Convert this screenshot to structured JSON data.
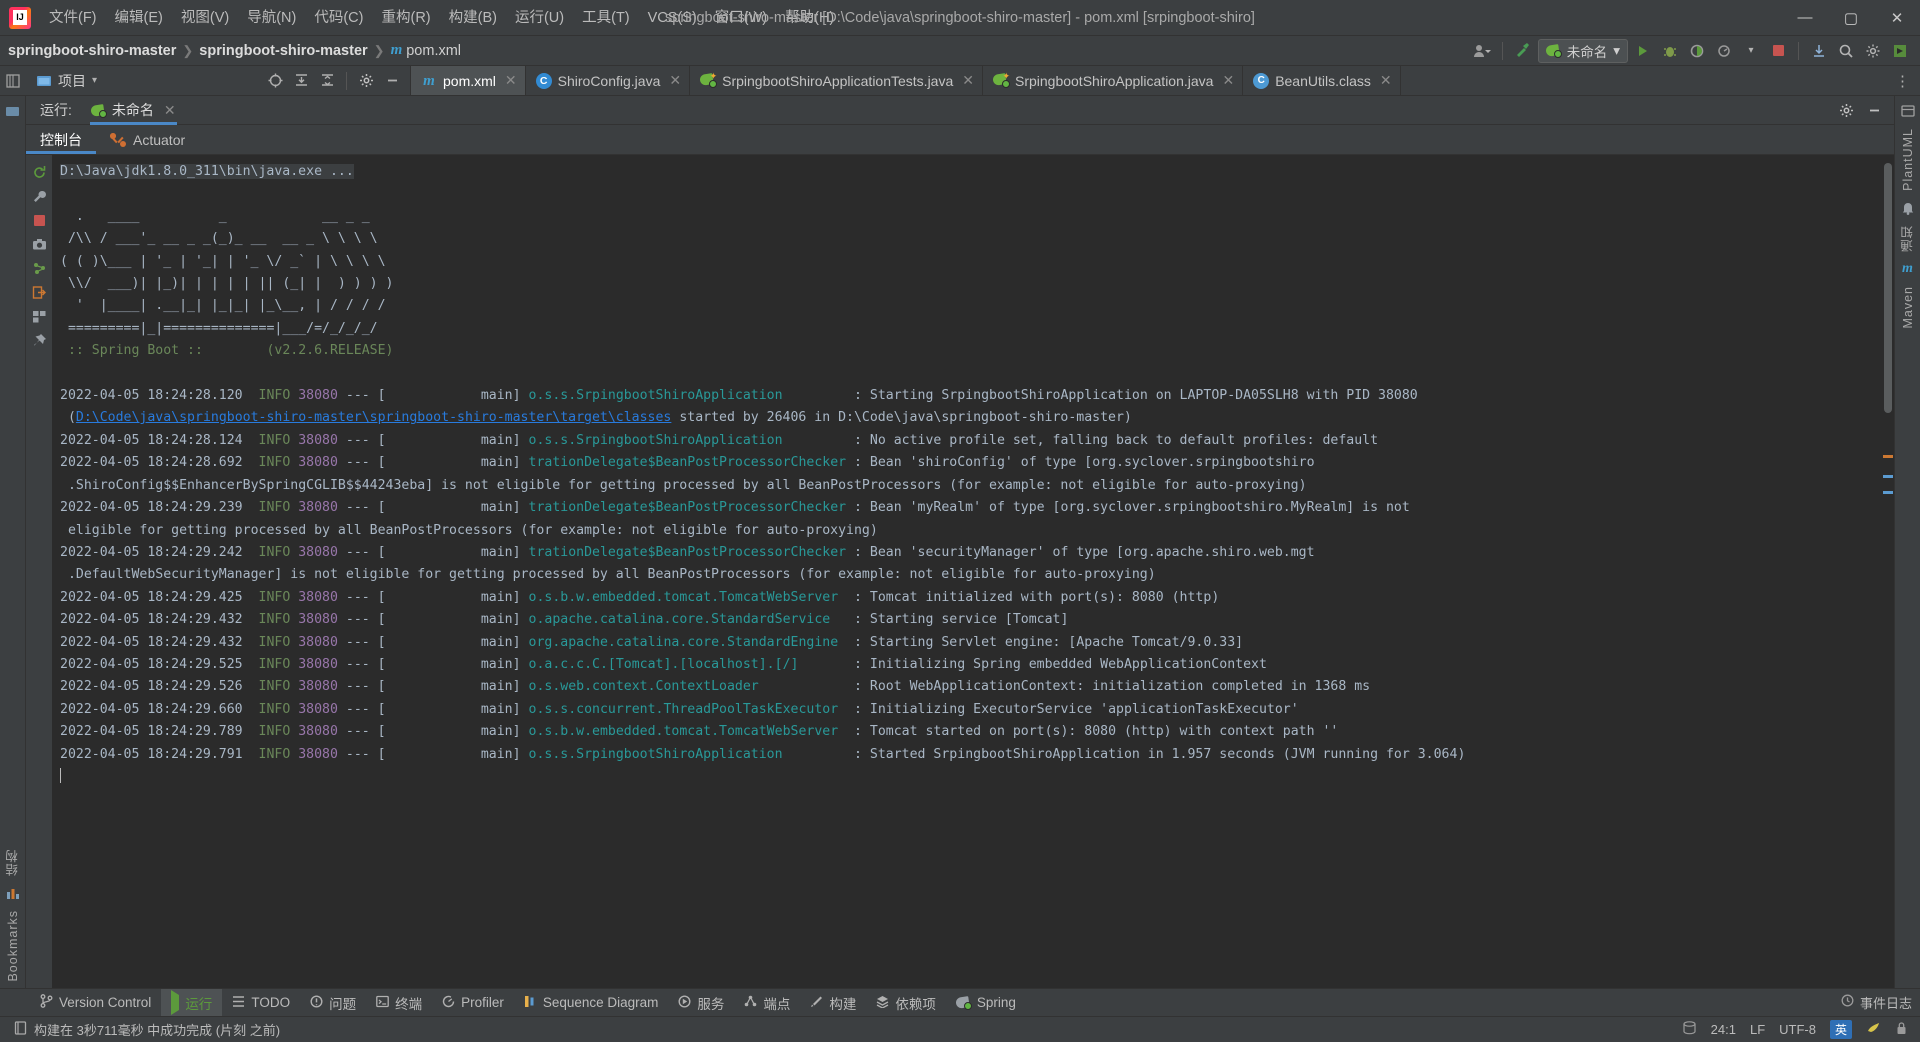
{
  "window": {
    "title": "springboot-shiro-master [D:\\Code\\java\\springboot-shiro-master] - pom.xml [srpingboot-shiro]",
    "minimize": "—",
    "maximize": "▢",
    "close": "✕"
  },
  "menu": {
    "items": [
      "文件(F)",
      "编辑(E)",
      "视图(V)",
      "导航(N)",
      "代码(C)",
      "重构(R)",
      "构建(B)",
      "运行(U)",
      "工具(T)",
      "VCS(S)",
      "窗口(W)",
      "帮助(H)"
    ]
  },
  "breadcrumb": {
    "root": "springboot-shiro-master",
    "module": "springboot-shiro-master",
    "file": "pom.xml",
    "sep": "❯"
  },
  "toolbar": {
    "run_config_name": "未命名",
    "search_icon": "🔍",
    "settings_icon": "⚙",
    "chevron": "▾"
  },
  "project_panel": {
    "label": "项目",
    "chevron": "▾"
  },
  "editor_tabs": [
    {
      "label": "pom.xml",
      "icon": "maven-icon",
      "active": true
    },
    {
      "label": "ShiroConfig.java",
      "icon": "java-class-icon",
      "active": false
    },
    {
      "label": "SrpingbootShiroApplicationTests.java",
      "icon": "spring-boot-icon",
      "active": false
    },
    {
      "label": "SrpingbootShiroApplication.java",
      "icon": "spring-boot-icon",
      "active": false
    },
    {
      "label": "BeanUtils.class",
      "icon": "compiled-class-icon",
      "active": false
    }
  ],
  "run_window": {
    "label": "运行:",
    "config_name": "未命名",
    "close": "✕",
    "subtabs": [
      {
        "label": "控制台",
        "active": true
      },
      {
        "label": "Actuator",
        "active": false
      }
    ]
  },
  "console": {
    "command": "D:\\Java\\jdk1.8.0_311\\bin\\java.exe ...",
    "banner": [
      "  .   ____          _            __ _ _",
      " /\\\\ / ___'_ __ _ _(_)_ __  __ _ \\ \\ \\ \\",
      "( ( )\\___ | '_ | '_| | '_ \\/ _` | \\ \\ \\ \\",
      " \\\\/  ___)| |_)| | | | | || (_| |  ) ) ) )",
      "  '  |____| .__|_| |_|_| |_\\__, | / / / /",
      " =========|_|==============|___/=/_/_/_/"
    ],
    "spring_tag": " :: Spring Boot ::        (v2.2.6.RELEASE)",
    "log_lines": [
      {
        "time": "2022-04-05 18:24:28.120",
        "level": "INFO",
        "pid": "38080",
        "thread": "main",
        "logger": "o.s.s.SrpingbootShiroApplication",
        "message": ": Starting SrpingbootShiroApplication on LAPTOP-DA05SLH8 with PID 38080",
        "continuation": "(D:\\Code\\java\\springboot-shiro-master\\springboot-shiro-master\\target\\classes started by 26406 in D:\\Code\\java\\springboot-shiro-master)",
        "continuation_link": "D:\\Code\\java\\springboot-shiro-master\\springboot-shiro-master\\target\\classes"
      },
      {
        "time": "2022-04-05 18:24:28.124",
        "level": "INFO",
        "pid": "38080",
        "thread": "main",
        "logger": "o.s.s.SrpingbootShiroApplication",
        "message": ": No active profile set, falling back to default profiles: default"
      },
      {
        "time": "2022-04-05 18:24:28.692",
        "level": "INFO",
        "pid": "38080",
        "thread": "main",
        "logger": "trationDelegate$BeanPostProcessorChecker",
        "message": ": Bean 'shiroConfig' of type [org.syclover.srpingbootshiro",
        "continuation": ".ShiroConfig$$EnhancerBySpringCGLIB$$44243eba] is not eligible for getting processed by all BeanPostProcessors (for example: not eligible for auto-proxying)"
      },
      {
        "time": "2022-04-05 18:24:29.239",
        "level": "INFO",
        "pid": "38080",
        "thread": "main",
        "logger": "trationDelegate$BeanPostProcessorChecker",
        "message": ": Bean 'myRealm' of type [org.syclover.srpingbootshiro.MyRealm] is not",
        "continuation": "eligible for getting processed by all BeanPostProcessors (for example: not eligible for auto-proxying)"
      },
      {
        "time": "2022-04-05 18:24:29.242",
        "level": "INFO",
        "pid": "38080",
        "thread": "main",
        "logger": "trationDelegate$BeanPostProcessorChecker",
        "message": ": Bean 'securityManager' of type [org.apache.shiro.web.mgt",
        "continuation": ".DefaultWebSecurityManager] is not eligible for getting processed by all BeanPostProcessors (for example: not eligible for auto-proxying)"
      },
      {
        "time": "2022-04-05 18:24:29.425",
        "level": "INFO",
        "pid": "38080",
        "thread": "main",
        "logger": "o.s.b.w.embedded.tomcat.TomcatWebServer",
        "message": ": Tomcat initialized with port(s): 8080 (http)"
      },
      {
        "time": "2022-04-05 18:24:29.432",
        "level": "INFO",
        "pid": "38080",
        "thread": "main",
        "logger": "o.apache.catalina.core.StandardService",
        "message": ": Starting service [Tomcat]"
      },
      {
        "time": "2022-04-05 18:24:29.432",
        "level": "INFO",
        "pid": "38080",
        "thread": "main",
        "logger": "org.apache.catalina.core.StandardEngine",
        "message": ": Starting Servlet engine: [Apache Tomcat/9.0.33]"
      },
      {
        "time": "2022-04-05 18:24:29.525",
        "level": "INFO",
        "pid": "38080",
        "thread": "main",
        "logger": "o.a.c.c.C.[Tomcat].[localhost].[/]",
        "message": ": Initializing Spring embedded WebApplicationContext"
      },
      {
        "time": "2022-04-05 18:24:29.526",
        "level": "INFO",
        "pid": "38080",
        "thread": "main",
        "logger": "o.s.web.context.ContextLoader",
        "message": ": Root WebApplicationContext: initialization completed in 1368 ms"
      },
      {
        "time": "2022-04-05 18:24:29.660",
        "level": "INFO",
        "pid": "38080",
        "thread": "main",
        "logger": "o.s.s.concurrent.ThreadPoolTaskExecutor",
        "message": ": Initializing ExecutorService 'applicationTaskExecutor'"
      },
      {
        "time": "2022-04-05 18:24:29.789",
        "level": "INFO",
        "pid": "38080",
        "thread": "main",
        "logger": "o.s.b.w.embedded.tomcat.TomcatWebServer",
        "message": ": Tomcat started on port(s): 8080 (http) with context path ''"
      },
      {
        "time": "2022-04-05 18:24:29.791",
        "level": "INFO",
        "pid": "38080",
        "thread": "main",
        "logger": "o.s.s.SrpingbootShiroApplication",
        "message": ": Started SrpingbootShiroApplication in 1.957 seconds (JVM running for 3.064)"
      }
    ]
  },
  "left_strip": {
    "structure": "结构",
    "bookmarks": "Bookmarks"
  },
  "right_strip": {
    "plantuml": "PlantUML",
    "notifications": "通知",
    "maven": "Maven"
  },
  "bottom_bar": {
    "items": [
      {
        "label": "Version Control",
        "icon": "branch-icon",
        "active": false
      },
      {
        "label": "运行",
        "icon": "run-icon",
        "active": true
      },
      {
        "label": "TODO",
        "icon": "todo-icon",
        "active": false
      },
      {
        "label": "问题",
        "icon": "problems-icon",
        "active": false
      },
      {
        "label": "终端",
        "icon": "terminal-icon",
        "active": false
      },
      {
        "label": "Profiler",
        "icon": "profiler-icon",
        "active": false
      },
      {
        "label": "Sequence Diagram",
        "icon": "sequence-diagram-icon",
        "active": false
      },
      {
        "label": "服务",
        "icon": "services-icon",
        "active": false
      },
      {
        "label": "端点",
        "icon": "endpoints-icon",
        "active": false
      },
      {
        "label": "构建",
        "icon": "build-icon",
        "active": false
      },
      {
        "label": "依赖项",
        "icon": "dependencies-icon",
        "active": false
      },
      {
        "label": "Spring",
        "icon": "spring-icon",
        "active": false
      }
    ],
    "right_label": "事件日志"
  },
  "status_bar": {
    "message": "构建在 3秒711毫秒 中成功完成 (片刻 之前)",
    "caret_position": "24:1",
    "line_separator": "LF",
    "encoding": "UTF-8",
    "ime": "英"
  },
  "colors": {
    "accent_blue": "#4a88c7",
    "spring_green": "#6db33f",
    "info_green": "#6a8759",
    "pid_purple": "#9876aa",
    "logger_teal": "#299999",
    "link_blue": "#287bde",
    "console_bg": "#2b2b2b",
    "chrome_bg": "#3c3f41"
  }
}
